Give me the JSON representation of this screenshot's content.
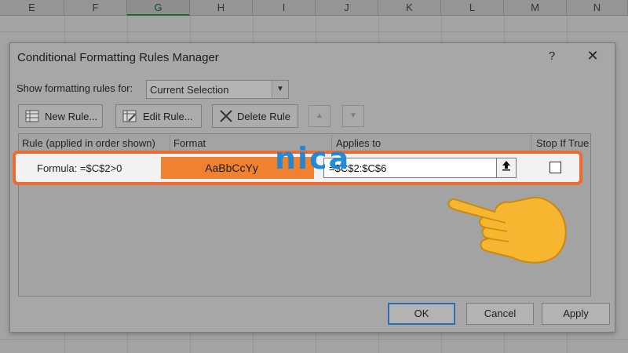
{
  "spreadsheet": {
    "columns": [
      "E",
      "F",
      "G",
      "H",
      "I",
      "J",
      "K",
      "L",
      "M",
      "N"
    ],
    "selected_column": "G"
  },
  "dialog": {
    "title": "Conditional Formatting Rules Manager",
    "help_label": "?",
    "close_label": "✕",
    "show_rules_label": "Show formatting rules for:",
    "show_rules_value": "Current Selection",
    "toolbar": {
      "new_rule_label": "New Rule...",
      "edit_rule_label": "Edit Rule...",
      "delete_rule_label": "Delete Rule"
    },
    "columns": {
      "rule": "Rule (applied in order shown)",
      "format": "Format",
      "applies_to": "Applies to",
      "stop_if_true": "Stop If True"
    },
    "rules": [
      {
        "description": "Formula: =$C$2>0",
        "format_preview": "AaBbCcYy",
        "applies_to": "=$C$2:$C$6",
        "stop_if_true": false
      }
    ],
    "buttons": {
      "ok": "OK",
      "cancel": "Cancel",
      "apply": "Apply"
    }
  },
  "overlay": {
    "watermark": "nica",
    "highlight_color": "#ee6a2e",
    "format_fill_color": "#ef8230",
    "hand_icon": "pointing-hand-icon"
  }
}
